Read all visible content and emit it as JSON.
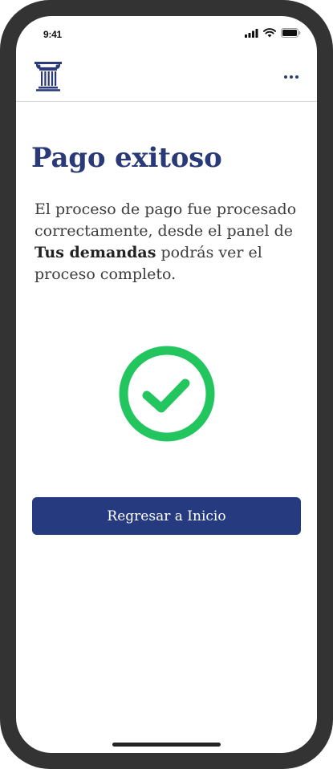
{
  "status_bar": {
    "time": "9:41"
  },
  "header": {
    "logo_icon": "greek-column-icon",
    "menu_icon": "more-horizontal-icon"
  },
  "main": {
    "title": "Pago exitoso",
    "message_part1": "El proceso de pago fue procesado correctamente, desde el panel de ",
    "message_bold": "Tus demandas",
    "message_part2": " podrás ver el proceso completo.",
    "success_icon": "check-circle-icon",
    "button_label": "Regresar a Inicio"
  },
  "colors": {
    "brand": "#263a80",
    "success": "#22c55e",
    "text": "#3c3c3c"
  }
}
